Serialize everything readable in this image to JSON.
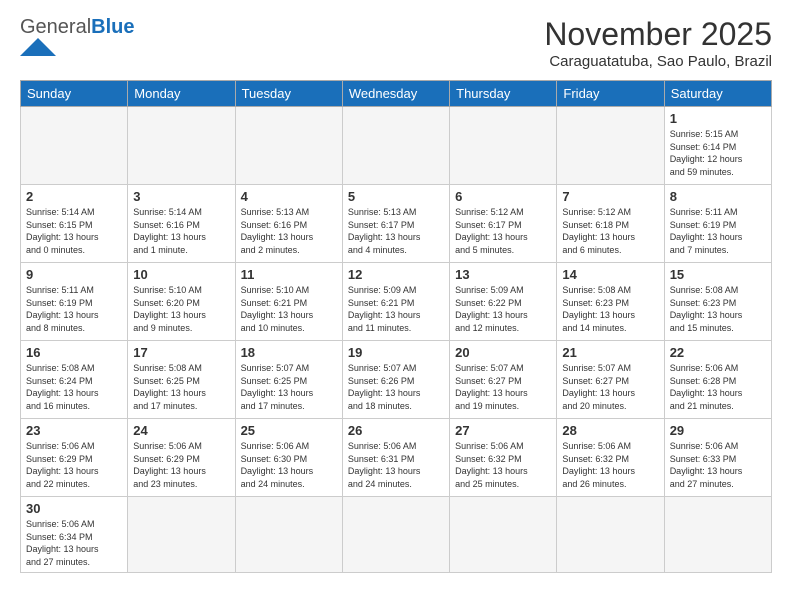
{
  "header": {
    "logo_general": "General",
    "logo_blue": "Blue",
    "month_title": "November 2025",
    "location": "Caraguatatuba, Sao Paulo, Brazil"
  },
  "weekdays": [
    "Sunday",
    "Monday",
    "Tuesday",
    "Wednesday",
    "Thursday",
    "Friday",
    "Saturday"
  ],
  "weeks": [
    [
      {
        "day": "",
        "info": "",
        "empty": true
      },
      {
        "day": "",
        "info": "",
        "empty": true
      },
      {
        "day": "",
        "info": "",
        "empty": true
      },
      {
        "day": "",
        "info": "",
        "empty": true
      },
      {
        "day": "",
        "info": "",
        "empty": true
      },
      {
        "day": "",
        "info": "",
        "empty": true
      },
      {
        "day": "1",
        "info": "Sunrise: 5:15 AM\nSunset: 6:14 PM\nDaylight: 12 hours\nand 59 minutes."
      }
    ],
    [
      {
        "day": "2",
        "info": "Sunrise: 5:14 AM\nSunset: 6:15 PM\nDaylight: 13 hours\nand 0 minutes."
      },
      {
        "day": "3",
        "info": "Sunrise: 5:14 AM\nSunset: 6:16 PM\nDaylight: 13 hours\nand 1 minute."
      },
      {
        "day": "4",
        "info": "Sunrise: 5:13 AM\nSunset: 6:16 PM\nDaylight: 13 hours\nand 2 minutes."
      },
      {
        "day": "5",
        "info": "Sunrise: 5:13 AM\nSunset: 6:17 PM\nDaylight: 13 hours\nand 4 minutes."
      },
      {
        "day": "6",
        "info": "Sunrise: 5:12 AM\nSunset: 6:17 PM\nDaylight: 13 hours\nand 5 minutes."
      },
      {
        "day": "7",
        "info": "Sunrise: 5:12 AM\nSunset: 6:18 PM\nDaylight: 13 hours\nand 6 minutes."
      },
      {
        "day": "8",
        "info": "Sunrise: 5:11 AM\nSunset: 6:19 PM\nDaylight: 13 hours\nand 7 minutes."
      }
    ],
    [
      {
        "day": "9",
        "info": "Sunrise: 5:11 AM\nSunset: 6:19 PM\nDaylight: 13 hours\nand 8 minutes."
      },
      {
        "day": "10",
        "info": "Sunrise: 5:10 AM\nSunset: 6:20 PM\nDaylight: 13 hours\nand 9 minutes."
      },
      {
        "day": "11",
        "info": "Sunrise: 5:10 AM\nSunset: 6:21 PM\nDaylight: 13 hours\nand 10 minutes."
      },
      {
        "day": "12",
        "info": "Sunrise: 5:09 AM\nSunset: 6:21 PM\nDaylight: 13 hours\nand 11 minutes."
      },
      {
        "day": "13",
        "info": "Sunrise: 5:09 AM\nSunset: 6:22 PM\nDaylight: 13 hours\nand 12 minutes."
      },
      {
        "day": "14",
        "info": "Sunrise: 5:08 AM\nSunset: 6:23 PM\nDaylight: 13 hours\nand 14 minutes."
      },
      {
        "day": "15",
        "info": "Sunrise: 5:08 AM\nSunset: 6:23 PM\nDaylight: 13 hours\nand 15 minutes."
      }
    ],
    [
      {
        "day": "16",
        "info": "Sunrise: 5:08 AM\nSunset: 6:24 PM\nDaylight: 13 hours\nand 16 minutes."
      },
      {
        "day": "17",
        "info": "Sunrise: 5:08 AM\nSunset: 6:25 PM\nDaylight: 13 hours\nand 17 minutes."
      },
      {
        "day": "18",
        "info": "Sunrise: 5:07 AM\nSunset: 6:25 PM\nDaylight: 13 hours\nand 17 minutes."
      },
      {
        "day": "19",
        "info": "Sunrise: 5:07 AM\nSunset: 6:26 PM\nDaylight: 13 hours\nand 18 minutes."
      },
      {
        "day": "20",
        "info": "Sunrise: 5:07 AM\nSunset: 6:27 PM\nDaylight: 13 hours\nand 19 minutes."
      },
      {
        "day": "21",
        "info": "Sunrise: 5:07 AM\nSunset: 6:27 PM\nDaylight: 13 hours\nand 20 minutes."
      },
      {
        "day": "22",
        "info": "Sunrise: 5:06 AM\nSunset: 6:28 PM\nDaylight: 13 hours\nand 21 minutes."
      }
    ],
    [
      {
        "day": "23",
        "info": "Sunrise: 5:06 AM\nSunset: 6:29 PM\nDaylight: 13 hours\nand 22 minutes."
      },
      {
        "day": "24",
        "info": "Sunrise: 5:06 AM\nSunset: 6:29 PM\nDaylight: 13 hours\nand 23 minutes."
      },
      {
        "day": "25",
        "info": "Sunrise: 5:06 AM\nSunset: 6:30 PM\nDaylight: 13 hours\nand 24 minutes."
      },
      {
        "day": "26",
        "info": "Sunrise: 5:06 AM\nSunset: 6:31 PM\nDaylight: 13 hours\nand 24 minutes."
      },
      {
        "day": "27",
        "info": "Sunrise: 5:06 AM\nSunset: 6:32 PM\nDaylight: 13 hours\nand 25 minutes."
      },
      {
        "day": "28",
        "info": "Sunrise: 5:06 AM\nSunset: 6:32 PM\nDaylight: 13 hours\nand 26 minutes."
      },
      {
        "day": "29",
        "info": "Sunrise: 5:06 AM\nSunset: 6:33 PM\nDaylight: 13 hours\nand 27 minutes."
      }
    ],
    [
      {
        "day": "30",
        "info": "Sunrise: 5:06 AM\nSunset: 6:34 PM\nDaylight: 13 hours\nand 27 minutes.",
        "last": true
      },
      {
        "day": "",
        "info": "",
        "empty": true,
        "last": true
      },
      {
        "day": "",
        "info": "",
        "empty": true,
        "last": true
      },
      {
        "day": "",
        "info": "",
        "empty": true,
        "last": true
      },
      {
        "day": "",
        "info": "",
        "empty": true,
        "last": true
      },
      {
        "day": "",
        "info": "",
        "empty": true,
        "last": true
      },
      {
        "day": "",
        "info": "",
        "empty": true,
        "last": true
      }
    ]
  ]
}
